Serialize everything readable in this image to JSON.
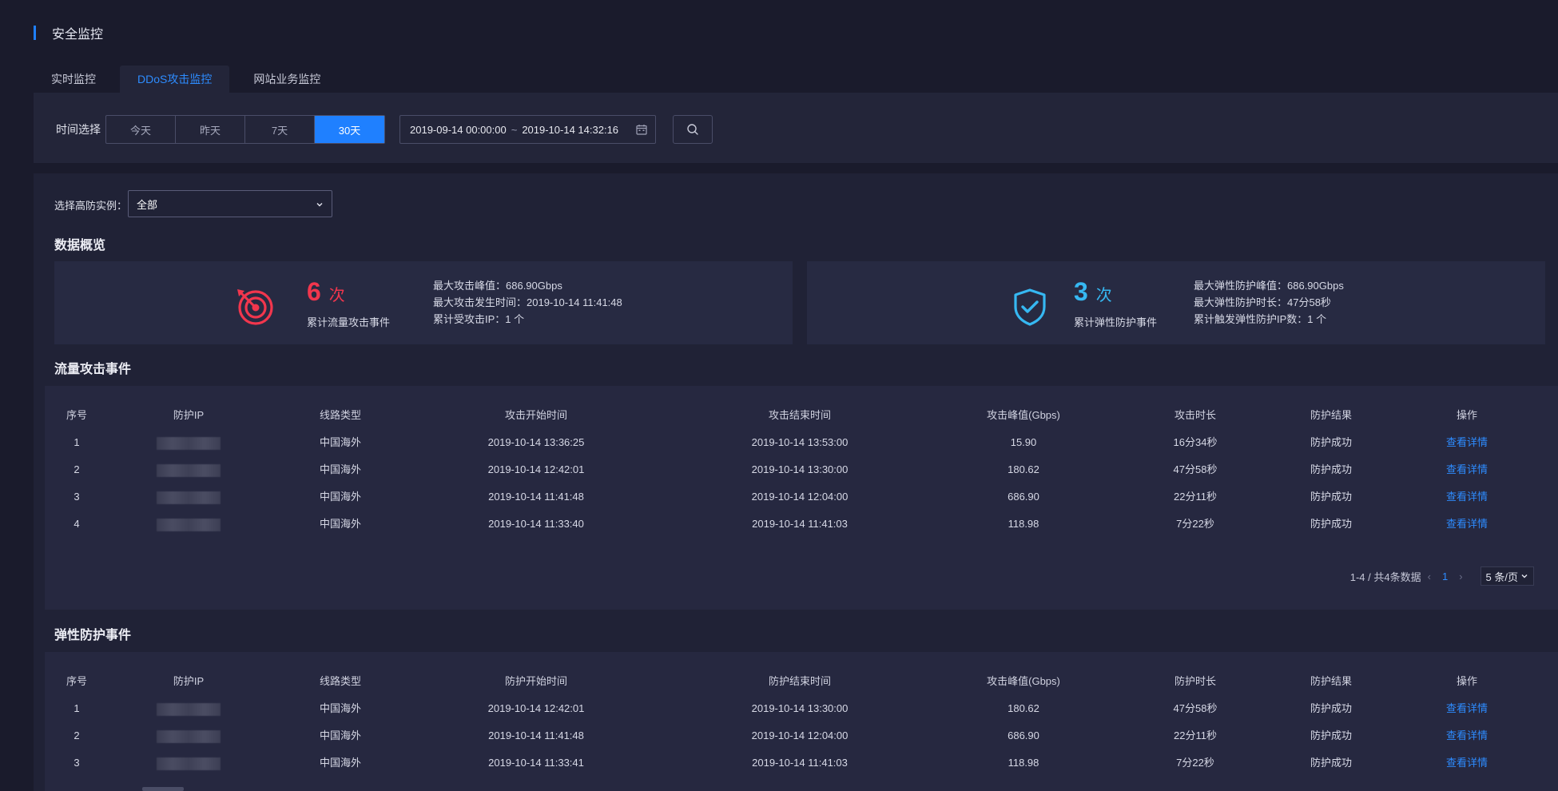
{
  "header": {
    "title": "安全监控"
  },
  "tabs": [
    {
      "label": "实时监控",
      "active": false
    },
    {
      "label": "DDoS攻击监控",
      "active": true
    },
    {
      "label": "网站业务监控",
      "active": false
    }
  ],
  "filter": {
    "label": "时间选择",
    "ranges": [
      {
        "label": "今天",
        "active": false
      },
      {
        "label": "昨天",
        "active": false
      },
      {
        "label": "7天",
        "active": false
      },
      {
        "label": "30天",
        "active": true
      }
    ],
    "date_start": "2019-09-14 00:00:00",
    "date_sep": "~",
    "date_end": "2019-10-14 14:32:16",
    "search_icon": "search-icon",
    "calendar_icon": "calendar-icon"
  },
  "instance": {
    "label": "选择高防实例：",
    "value": "全部"
  },
  "overview": {
    "title": "数据概览",
    "attack": {
      "icon": "target-icon",
      "count": "6",
      "unit": "次",
      "label": "累计流量攻击事件",
      "stats": [
        "最大攻击峰值：686.90Gbps",
        "最大攻击发生时间：2019-10-14 11:41:48",
        "累计受攻击IP：1 个"
      ],
      "color": "#f2364d"
    },
    "protect": {
      "icon": "shield-check-icon",
      "count": "3",
      "unit": "次",
      "label": "累计弹性防护事件",
      "stats": [
        "最大弹性防护峰值：686.90Gbps",
        "最大弹性防护时长：47分58秒",
        "累计触发弹性防护IP数：1 个"
      ],
      "color": "#36b8f2"
    }
  },
  "attack_events": {
    "title": "流量攻击事件",
    "columns": [
      "序号",
      "防护IP",
      "线路类型",
      "攻击开始时间",
      "攻击结束时间",
      "攻击峰值(Gbps)",
      "攻击时长",
      "防护结果",
      "操作"
    ],
    "rows": [
      {
        "no": "1",
        "line": "中国海外",
        "start": "2019-10-14 13:36:25",
        "end": "2019-10-14 13:53:00",
        "peak": "15.90",
        "duration": "16分34秒",
        "result": "防护成功",
        "action": "查看详情"
      },
      {
        "no": "2",
        "line": "中国海外",
        "start": "2019-10-14 12:42:01",
        "end": "2019-10-14 13:30:00",
        "peak": "180.62",
        "duration": "47分58秒",
        "result": "防护成功",
        "action": "查看详情"
      },
      {
        "no": "3",
        "line": "中国海外",
        "start": "2019-10-14 11:41:48",
        "end": "2019-10-14 12:04:00",
        "peak": "686.90",
        "duration": "22分11秒",
        "result": "防护成功",
        "action": "查看详情"
      },
      {
        "no": "4",
        "line": "中国海外",
        "start": "2019-10-14 11:33:40",
        "end": "2019-10-14 11:41:03",
        "peak": "118.98",
        "duration": "7分22秒",
        "result": "防护成功",
        "action": "查看详情"
      }
    ],
    "pager": {
      "summary": "1-4 / 共4条数据",
      "current": "1",
      "prev": "‹",
      "next": "›",
      "page_size": "5 条/页"
    }
  },
  "protect_events": {
    "title": "弹性防护事件",
    "columns": [
      "序号",
      "防护IP",
      "线路类型",
      "防护开始时间",
      "防护结束时间",
      "攻击峰值(Gbps)",
      "防护时长",
      "防护结果",
      "操作"
    ],
    "rows": [
      {
        "no": "1",
        "line": "中国海外",
        "start": "2019-10-14 12:42:01",
        "end": "2019-10-14 13:30:00",
        "peak": "180.62",
        "duration": "47分58秒",
        "result": "防护成功",
        "action": "查看详情"
      },
      {
        "no": "2",
        "line": "中国海外",
        "start": "2019-10-14 11:41:48",
        "end": "2019-10-14 12:04:00",
        "peak": "686.90",
        "duration": "22分11秒",
        "result": "防护成功",
        "action": "查看详情"
      },
      {
        "no": "3",
        "line": "中国海外",
        "start": "2019-10-14 11:33:41",
        "end": "2019-10-14 11:41:03",
        "peak": "118.98",
        "duration": "7分22秒",
        "result": "防护成功",
        "action": "查看详情"
      }
    ]
  }
}
